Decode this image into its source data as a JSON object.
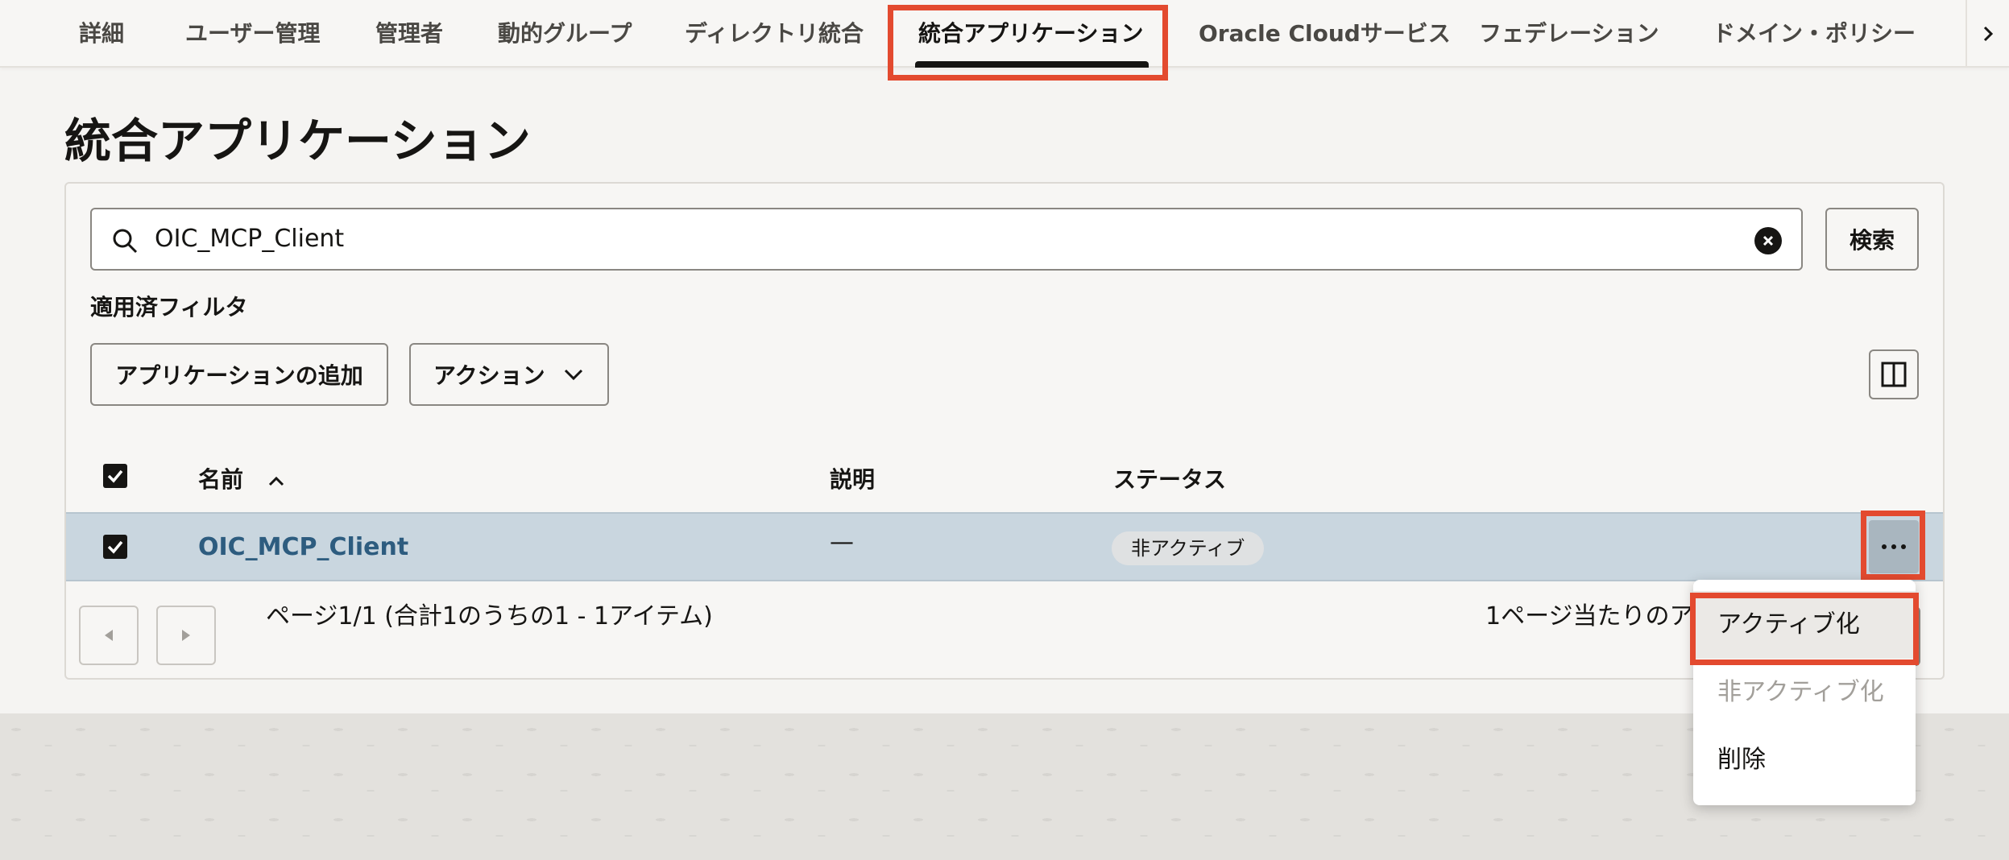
{
  "tabs": {
    "items": [
      "詳細",
      "ユーザー管理",
      "管理者",
      "動的グループ",
      "ディレクトリ統合",
      "統合アプリケーション",
      "Oracle Cloudサービス",
      "フェデレーション",
      "ドメイン・ポリシー"
    ]
  },
  "page": {
    "title": "統合アプリケーション"
  },
  "search": {
    "value": "OIC_MCP_Client",
    "button_label": "検索"
  },
  "filters": {
    "label": "適用済フィルタ"
  },
  "toolbar": {
    "add_label": "アプリケーションの追加",
    "actions_label": "アクション"
  },
  "table": {
    "headers": {
      "name": "名前",
      "description": "説明",
      "status": "ステータス"
    },
    "rows": [
      {
        "name": "OIC_MCP_Client",
        "description": "—",
        "status": "非アクティブ"
      }
    ]
  },
  "pagination": {
    "summary": "ページ1/1 (合計1のうちの1 - 1アイテム)",
    "per_page_label": "1ページ当たりのアイ"
  },
  "menu": {
    "activate": "アクティブ化",
    "deactivate": "非アクティブ化",
    "delete": "削除"
  }
}
